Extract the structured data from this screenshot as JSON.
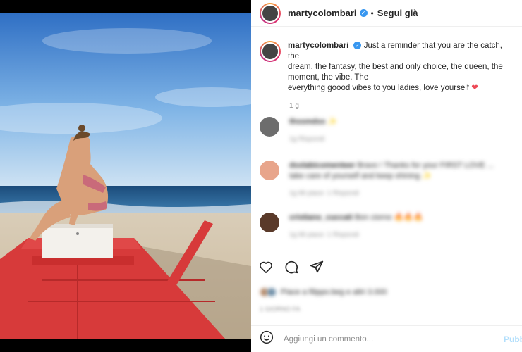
{
  "post": {
    "username": "martycolombari",
    "verified_mark": "✓",
    "separator": "•",
    "follow_label": "Segui già"
  },
  "caption": {
    "username": "martycolombari",
    "text_line1": "Just a reminder that you are the catch, the",
    "text_line2": "dream, the fantasy, the best and only choice, the queen, the",
    "text_line3": "moment, the vibe. The",
    "text_line4": "everything goood vibes to you ladies, love yourself",
    "heart": "❤",
    "time": "1 g"
  },
  "comments": [
    {
      "user": "thssmdxx",
      "text": "✨",
      "meta": "1g   Rispondi",
      "avatar_color": "#6d6d6d"
    },
    {
      "user": "dxxlabicomenteer",
      "text": "Bravo ! Thanks for your FIRST LOVE ... take care of yourself and keep shining ✨",
      "meta": "1g   Mi piace: 1   Rispondi",
      "avatar_color": "#e8a58b"
    },
    {
      "user": "cristiano_cuccati",
      "text": "Bon ciorno 🔥🔥🔥",
      "meta": "1g   Mi piace: 1   Rispondi",
      "avatar_color": "#5a3a2a"
    }
  ],
  "actions": {
    "like_icon": "heart-outline",
    "comment_icon": "comment-bubble",
    "share_icon": "paper-plane"
  },
  "likes": {
    "text": "Piace a filippo.beg e altri 3.000"
  },
  "date": {
    "text": "1 GIORNO FA"
  },
  "add_comment": {
    "emoji_icon": "smile",
    "placeholder": "Aggiungi un commento...",
    "publish_label": "Pubblica"
  }
}
